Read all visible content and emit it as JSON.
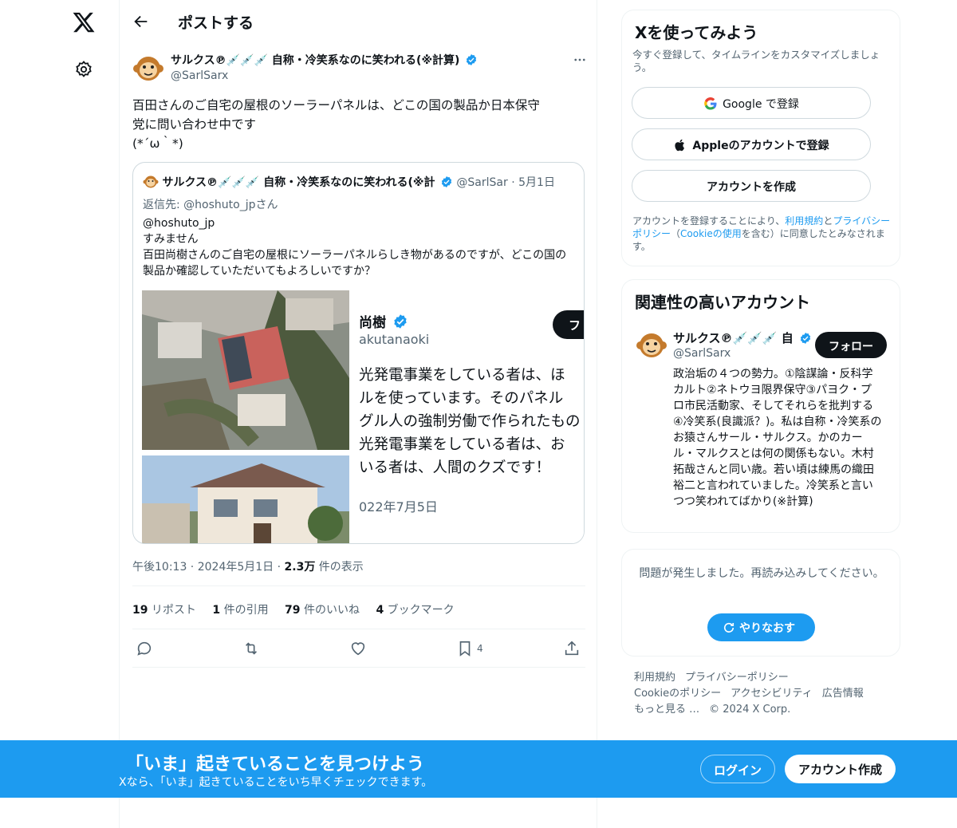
{
  "colors": {
    "accent": "#1d9bf0",
    "text": "#0f1419",
    "muted": "#536471",
    "border": "#cfd9de"
  },
  "nav": {
    "logo_icon": "x-logo-icon",
    "settings_icon": "gear-icon"
  },
  "header": {
    "back_icon": "arrow-left-icon",
    "title": "ポストする"
  },
  "post": {
    "author_name": "サルクス℗💉💉💉 自称・冷笑系なのに笑われる(※計算)",
    "handle": "@SarlSarx",
    "text_line1": "百田さんのご自宅の屋根のソーラーパネルは、どこの国の製品か日本保守",
    "text_line2": "党に問い合わせ中です",
    "text_line3": "(*´ω｀*)",
    "quote": {
      "author_name": "サルクス℗💉💉💉 自称・冷笑系なのに笑われる(※計",
      "handle": "@SarlSar",
      "dot": " · ",
      "date": "5月1日",
      "reply_to": "返信先: @hoshuto_jpさん",
      "body": "@hoshuto_jp\nすみません\n百田尚樹さんのご自宅の屋根にソーラーパネルらしき物があるのですが、どこの国の製品か確認していただいてもよろしいですか？",
      "media": {
        "shot_name": "尚樹",
        "shot_handle": "akutanaoki",
        "shot_button": "フ",
        "shot_lines": [
          "光発電事業をしている者は、ほ",
          "ルを使っています。そのパネル",
          "グル人の強制労働で作られたもの",
          "光発電事業をしている者は、お",
          "いる者は、人間のクズです！"
        ],
        "shot_date": "022年7月5日"
      }
    },
    "time": "午後10:13",
    "sep": " · ",
    "date": "2024年5月1日",
    "views_count": "2.3万",
    "views_label": " 件の表示",
    "stats": {
      "reposts_count": "19",
      "reposts_label": " リポスト",
      "quotes_count": "1",
      "quotes_label": " 件の引用",
      "likes_count": "79",
      "likes_label": " 件のいいね",
      "bookmarks_count": "4",
      "bookmarks_label": " ブックマーク"
    },
    "bookmark_count_small": "4"
  },
  "signup_panel": {
    "title": "Xを使ってみよう",
    "subtitle": "今すぐ登録して、タイムラインをカスタマイズしましょう。",
    "google_label": "Google で登録",
    "apple_label": "Appleのアカウントで登録",
    "create_label": "アカウントを作成",
    "terms_pre": "アカウントを登録することにより、",
    "terms_link1": "利用規約",
    "terms_and": "と",
    "terms_link2": "プライバシーポリシー",
    "terms_mid": "（",
    "terms_link3": "Cookieの使用",
    "terms_post": "を含む）に同意したとみなされます。"
  },
  "related_panel": {
    "title": "関連性の高いアカウント",
    "name": "サルクス℗💉💉💉 自",
    "handle": "@SarlSarx",
    "follow_label": "フォロー",
    "bio": "政治垢の４つの勢力。①陰謀論・反科学カルト②ネトウヨ限界保守③パヨク・プロ市民活動家、そしてそれらを批判する④冷笑系(良識派？)。私は自称・冷笑系のお猿さんサール・サルクス。かのカール・マルクスとは何の関係もない。木村拓哉さんと同い歳。若い頃は練馬の織田裕二と言われていました。冷笑系と言いつつ笑われてばかり(※計算)"
  },
  "error_panel": {
    "message": "問題が発生しました。再読み込みしてください。",
    "retry_label": "やりなおす"
  },
  "footer": {
    "links": [
      "利用規約",
      "プライバシーポリシー",
      "Cookieのポリシー",
      "アクセシビリティ",
      "広告情報",
      "もっと見る …",
      "© 2024 X Corp."
    ]
  },
  "banner": {
    "title": "「いま」起きていることを見つけよう",
    "subtitle": "Xなら、「いま」起きていることをいち早くチェックできます。",
    "login_label": "ログイン",
    "create_label": "アカウント作成"
  }
}
